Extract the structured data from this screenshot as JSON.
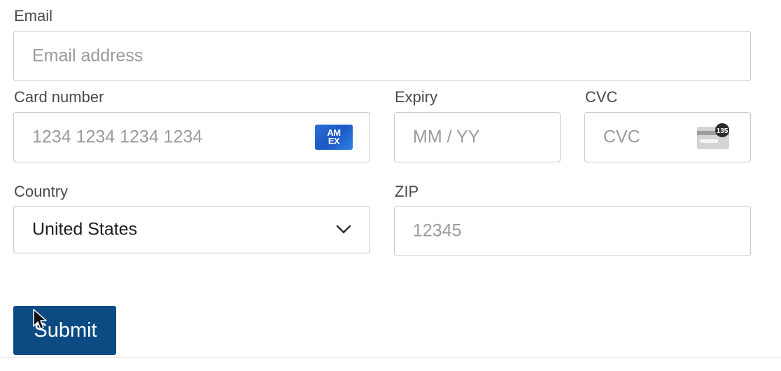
{
  "email": {
    "label": "Email",
    "placeholder": "Email address"
  },
  "card_number": {
    "label": "Card number",
    "placeholder": "1234 1234 1234 1234",
    "brand_icon": "amex-card-icon",
    "brand_text": "AM EX"
  },
  "expiry": {
    "label": "Expiry",
    "placeholder": "MM / YY"
  },
  "cvc": {
    "label": "CVC",
    "placeholder": "CVC",
    "icon": "cvc-card-icon",
    "icon_text": "135"
  },
  "country": {
    "label": "Country",
    "value": "United States"
  },
  "zip": {
    "label": "ZIP",
    "placeholder": "12345"
  },
  "submit": {
    "label": "Submit"
  },
  "colors": {
    "button": "#0b4a83",
    "border": "#c9c9c9",
    "placeholder": "#9b9b9b",
    "amex": "#1b58c4"
  }
}
